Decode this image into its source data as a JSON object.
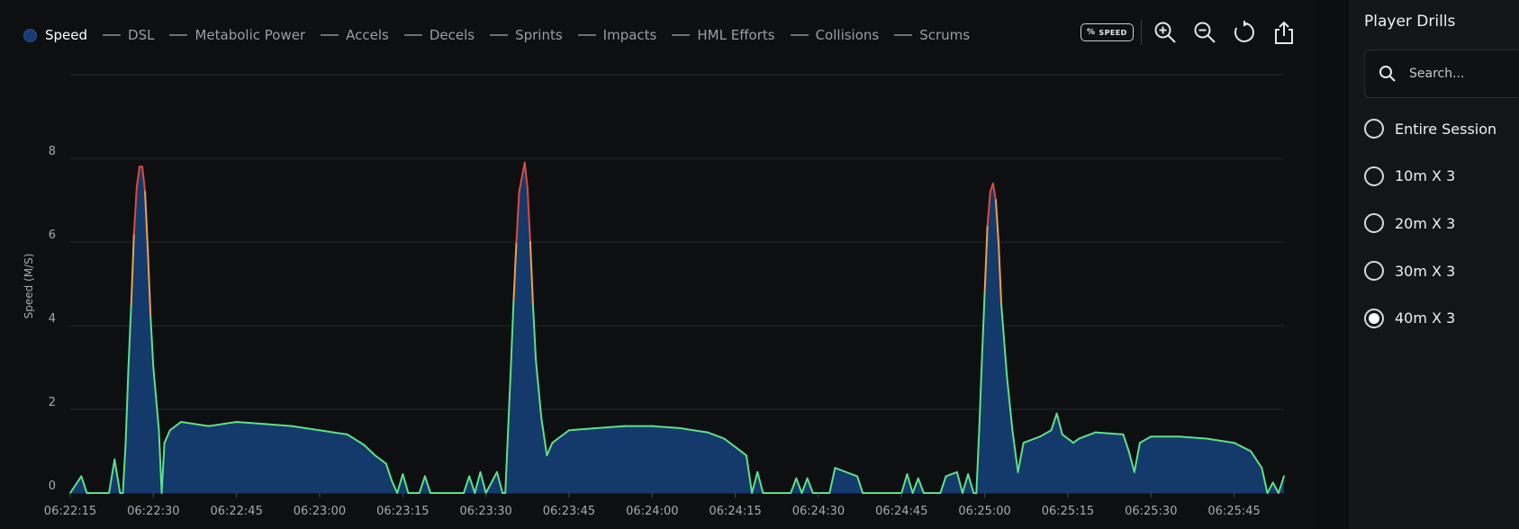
{
  "legend": {
    "items": [
      {
        "label": "Speed",
        "active": true
      },
      {
        "label": "DSL",
        "active": false
      },
      {
        "label": "Metabolic Power",
        "active": false
      },
      {
        "label": "Accels",
        "active": false
      },
      {
        "label": "Decels",
        "active": false
      },
      {
        "label": "Sprints",
        "active": false
      },
      {
        "label": "Impacts",
        "active": false
      },
      {
        "label": "HML Efforts",
        "active": false
      },
      {
        "label": "Collisions",
        "active": false
      },
      {
        "label": "Scrums",
        "active": false
      }
    ]
  },
  "toolbar": {
    "percent_label": "%",
    "speed_badge_label": "SPEED",
    "icons": [
      "zoom-in-icon",
      "zoom-out-icon",
      "reset-icon",
      "share-icon"
    ]
  },
  "chart_data": {
    "type": "area",
    "title": "",
    "xlabel": "",
    "ylabel": "Speed (M/S)",
    "ylim": [
      0,
      10
    ],
    "y_ticks": [
      0,
      2,
      4,
      6,
      8
    ],
    "x_ticks": [
      "06:22:15",
      "06:22:30",
      "06:22:45",
      "06:23:00",
      "06:23:15",
      "06:23:30",
      "06:23:45",
      "06:24:00",
      "06:24:15",
      "06:24:30",
      "06:24:45",
      "06:25:00",
      "06:25:15",
      "06:25:30",
      "06:25:45"
    ],
    "x_range": [
      "06:22:15",
      "06:25:54"
    ],
    "grid": true,
    "fill_color": "#153d73",
    "line_colors": {
      "low": "#5ee089",
      "mid": "#f0a246",
      "high": "#dd4a3a"
    },
    "series": [
      {
        "values_by_time": [
          [
            "06:22:15",
            0.0
          ],
          [
            "06:22:17",
            0.4
          ],
          [
            "06:22:18",
            0.0
          ],
          [
            "06:22:22",
            0.0
          ],
          [
            "06:22:23",
            0.8
          ],
          [
            "06:22:24",
            0.0
          ],
          [
            "06:22:24.5",
            0.0
          ],
          [
            "06:22:25",
            1.2
          ],
          [
            "06:22:25.5",
            3.0
          ],
          [
            "06:22:26",
            4.5
          ],
          [
            "06:22:26.5",
            6.2
          ],
          [
            "06:22:27",
            7.3
          ],
          [
            "06:22:27.5",
            7.8
          ],
          [
            "06:22:28",
            7.8
          ],
          [
            "06:22:28.5",
            7.2
          ],
          [
            "06:22:29",
            5.8
          ],
          [
            "06:22:29.5",
            4.2
          ],
          [
            "06:22:30",
            3.0
          ],
          [
            "06:22:31",
            1.5
          ],
          [
            "06:22:31.5",
            0.0
          ],
          [
            "06:22:32",
            1.2
          ],
          [
            "06:22:33",
            1.5
          ],
          [
            "06:22:35",
            1.7
          ],
          [
            "06:22:40",
            1.6
          ],
          [
            "06:22:45",
            1.7
          ],
          [
            "06:22:50",
            1.65
          ],
          [
            "06:22:55",
            1.6
          ],
          [
            "06:23:00",
            1.5
          ],
          [
            "06:23:05",
            1.4
          ],
          [
            "06:23:08",
            1.15
          ],
          [
            "06:23:10",
            0.9
          ],
          [
            "06:23:12",
            0.7
          ],
          [
            "06:23:13",
            0.3
          ],
          [
            "06:23:14",
            0.0
          ],
          [
            "06:23:15",
            0.45
          ],
          [
            "06:23:16",
            0.0
          ],
          [
            "06:23:18",
            0.0
          ],
          [
            "06:23:19",
            0.4
          ],
          [
            "06:23:20",
            0.0
          ],
          [
            "06:23:26",
            0.0
          ],
          [
            "06:23:27",
            0.4
          ],
          [
            "06:23:28",
            0.0
          ],
          [
            "06:23:29",
            0.5
          ],
          [
            "06:23:30",
            0.0
          ],
          [
            "06:23:32",
            0.5
          ],
          [
            "06:23:33",
            0.0
          ],
          [
            "06:23:33.5",
            0.0
          ],
          [
            "06:23:34",
            1.5
          ],
          [
            "06:23:34.5",
            3.0
          ],
          [
            "06:23:35",
            4.6
          ],
          [
            "06:23:35.5",
            6.0
          ],
          [
            "06:23:36",
            7.2
          ],
          [
            "06:23:37",
            7.9
          ],
          [
            "06:23:37.5",
            7.3
          ],
          [
            "06:23:38",
            6.0
          ],
          [
            "06:23:38.5",
            4.5
          ],
          [
            "06:23:39",
            3.2
          ],
          [
            "06:23:40",
            1.8
          ],
          [
            "06:23:41",
            0.9
          ],
          [
            "06:23:42",
            1.2
          ],
          [
            "06:23:45",
            1.5
          ],
          [
            "06:23:50",
            1.55
          ],
          [
            "06:23:55",
            1.6
          ],
          [
            "06:24:00",
            1.6
          ],
          [
            "06:24:05",
            1.55
          ],
          [
            "06:24:10",
            1.45
          ],
          [
            "06:24:13",
            1.3
          ],
          [
            "06:24:15",
            1.1
          ],
          [
            "06:24:17",
            0.9
          ],
          [
            "06:24:18",
            0.0
          ],
          [
            "06:24:19",
            0.5
          ],
          [
            "06:24:20",
            0.0
          ],
          [
            "06:24:25",
            0.0
          ],
          [
            "06:24:26",
            0.35
          ],
          [
            "06:24:27",
            0.0
          ],
          [
            "06:24:28",
            0.35
          ],
          [
            "06:24:29",
            0.0
          ],
          [
            "06:24:32",
            0.0
          ],
          [
            "06:24:33",
            0.6
          ],
          [
            "06:24:35",
            0.5
          ],
          [
            "06:24:37",
            0.4
          ],
          [
            "06:24:38",
            0.0
          ],
          [
            "06:24:45",
            0.0
          ],
          [
            "06:24:46",
            0.45
          ],
          [
            "06:24:47",
            0.0
          ],
          [
            "06:24:48",
            0.35
          ],
          [
            "06:24:49",
            0.0
          ],
          [
            "06:24:52",
            0.0
          ],
          [
            "06:24:53",
            0.4
          ],
          [
            "06:24:55",
            0.5
          ],
          [
            "06:24:56",
            0.0
          ],
          [
            "06:24:57",
            0.45
          ],
          [
            "06:24:58",
            0.0
          ],
          [
            "06:24:58.5",
            0.0
          ],
          [
            "06:24:59",
            1.5
          ],
          [
            "06:24:59.5",
            3.2
          ],
          [
            "06:25:00",
            4.8
          ],
          [
            "06:25:00.5",
            6.4
          ],
          [
            "06:25:01",
            7.2
          ],
          [
            "06:25:01.5",
            7.4
          ],
          [
            "06:25:02",
            7.0
          ],
          [
            "06:25:02.5",
            6.0
          ],
          [
            "06:25:03",
            4.5
          ],
          [
            "06:25:04",
            2.8
          ],
          [
            "06:25:05",
            1.5
          ],
          [
            "06:25:06",
            0.5
          ],
          [
            "06:25:07",
            1.2
          ],
          [
            "06:25:10",
            1.35
          ],
          [
            "06:25:12",
            1.5
          ],
          [
            "06:25:13",
            1.9
          ],
          [
            "06:25:14",
            1.4
          ],
          [
            "06:25:16",
            1.2
          ],
          [
            "06:25:17",
            1.3
          ],
          [
            "06:25:20",
            1.45
          ],
          [
            "06:25:25",
            1.4
          ],
          [
            "06:25:26",
            1.0
          ],
          [
            "06:25:27",
            0.5
          ],
          [
            "06:25:28",
            1.2
          ],
          [
            "06:25:30",
            1.35
          ],
          [
            "06:25:35",
            1.35
          ],
          [
            "06:25:40",
            1.3
          ],
          [
            "06:25:45",
            1.2
          ],
          [
            "06:25:48",
            1.0
          ],
          [
            "06:25:50",
            0.6
          ],
          [
            "06:25:51",
            0.0
          ],
          [
            "06:25:52",
            0.25
          ],
          [
            "06:25:53",
            0.0
          ],
          [
            "06:25:54",
            0.4
          ]
        ]
      }
    ]
  },
  "sidebar": {
    "title": "Player Drills",
    "search_placeholder": "Search...",
    "drills": [
      {
        "label": "Entire Session",
        "selected": false
      },
      {
        "label": "10m X 3",
        "selected": false
      },
      {
        "label": "20m X 3",
        "selected": false
      },
      {
        "label": "30m X 3",
        "selected": false
      },
      {
        "label": "40m X 3",
        "selected": true
      }
    ]
  }
}
